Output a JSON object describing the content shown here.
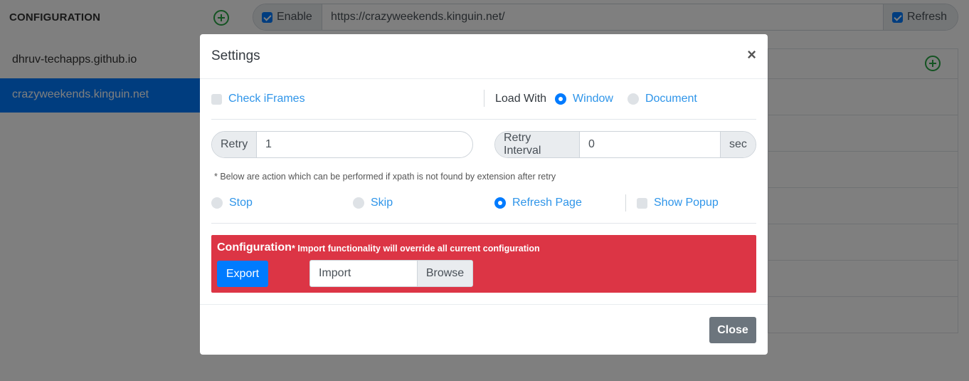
{
  "background": {
    "sidebar_title": "CONFIGURATION",
    "sites": [
      "dhruv-techapps.github.io",
      "crazyweekends.kinguin.net"
    ],
    "url_bar": {
      "enable_label": "Enable",
      "url": "https://crazyweekends.kinguin.net/",
      "refresh_label": "Refresh"
    }
  },
  "modal": {
    "title": "Settings",
    "close_x": "×",
    "check_iframes": "Check iFrames",
    "load_with": {
      "label": "Load With",
      "options": [
        "Window",
        "Document"
      ],
      "selected": "Window"
    },
    "retry": {
      "label": "Retry",
      "value": "1"
    },
    "retry_interval": {
      "label": "Retry Interval",
      "value": "0",
      "unit": "sec"
    },
    "note": "* Below are action which can be performed if xpath is not found by extension after retry",
    "actions": {
      "options": [
        "Stop",
        "Skip",
        "Refresh Page"
      ],
      "selected": "Refresh Page",
      "show_popup": "Show Popup"
    },
    "configuration": {
      "title": "Configuration",
      "warning": "* Import functionality will override all current configuration",
      "export": "Export",
      "import_placeholder": "Import",
      "browse": "Browse"
    },
    "footer": {
      "close": "Close"
    }
  },
  "colors": {
    "primary": "#007bff",
    "danger": "#dc3545",
    "secondary": "#6c757d",
    "success": "#28a745"
  }
}
